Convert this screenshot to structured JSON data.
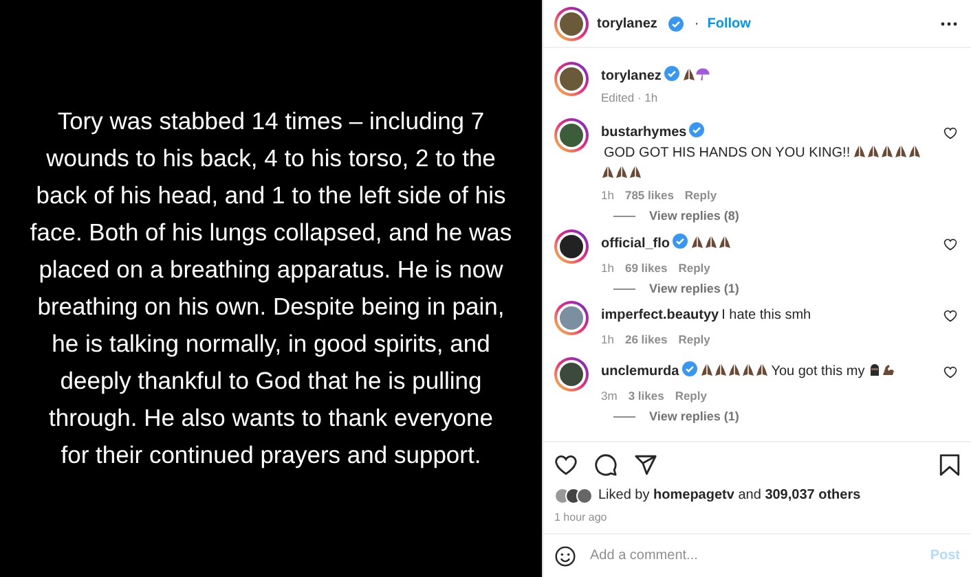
{
  "story": {
    "lines": [
      "Tory was stabbed 14 times – including 7",
      "wounds to his back, 4 to his torso, 2 to the",
      "back of his head, and 1 to the left side of his",
      "face. Both of his lungs collapsed, and he was",
      "placed on a breathing apparatus. He is now",
      "breathing on his own. Despite being in pain,",
      "he is talking normally, in good spirits, and",
      "deeply thankful to God that he is pulling",
      "through. He also wants to thank everyone",
      "for their continued prayers and support."
    ]
  },
  "header": {
    "username": "torylanez",
    "verified": true,
    "separator": "·",
    "follow": "Follow"
  },
  "caption": {
    "username": "torylanez",
    "verified": true,
    "parts": [
      {
        "kind": "pray"
      },
      {
        "kind": "umbrella"
      }
    ],
    "meta": "Edited · 1h"
  },
  "comments": [
    {
      "username": "bustarhymes",
      "verified": true,
      "parts": [
        {
          "kind": "text",
          "text": "GOD GOT HIS HANDS ON YOU KING!!"
        },
        {
          "kind": "pray"
        },
        {
          "kind": "pray"
        },
        {
          "kind": "pray"
        },
        {
          "kind": "pray"
        },
        {
          "kind": "pray"
        },
        {
          "kind": "pray"
        },
        {
          "kind": "pray"
        },
        {
          "kind": "pray"
        }
      ],
      "time": "1h",
      "likes": "785 likes",
      "reply": "Reply",
      "view_replies": "View replies (8)"
    },
    {
      "username": "official_flo",
      "verified": true,
      "parts": [
        {
          "kind": "pray"
        },
        {
          "kind": "pray"
        },
        {
          "kind": "pray"
        }
      ],
      "time": "1h",
      "likes": "69 likes",
      "reply": "Reply",
      "view_replies": "View replies (1)"
    },
    {
      "username": "imperfect.beautyy",
      "verified": false,
      "parts": [
        {
          "kind": "text",
          "text": "I hate this smh"
        }
      ],
      "time": "1h",
      "likes": "26 likes",
      "reply": "Reply"
    },
    {
      "username": "unclemurda",
      "verified": true,
      "parts": [
        {
          "kind": "pray"
        },
        {
          "kind": "pray"
        },
        {
          "kind": "pray"
        },
        {
          "kind": "pray"
        },
        {
          "kind": "pray"
        },
        {
          "kind": "text",
          "text": "You got this my"
        },
        {
          "kind": "ninja"
        },
        {
          "kind": "muscle"
        }
      ],
      "time": "3m",
      "likes": "3 likes",
      "reply": "Reply",
      "view_replies": "View replies (1)"
    }
  ],
  "likes": {
    "prefix": "Liked by",
    "user": "homepagetv",
    "middle": "and",
    "count": "309,037 others"
  },
  "time_ago": "1 hour ago",
  "add_comment": {
    "placeholder": "Add a comment...",
    "post": "Post",
    "post_disabled": true
  }
}
